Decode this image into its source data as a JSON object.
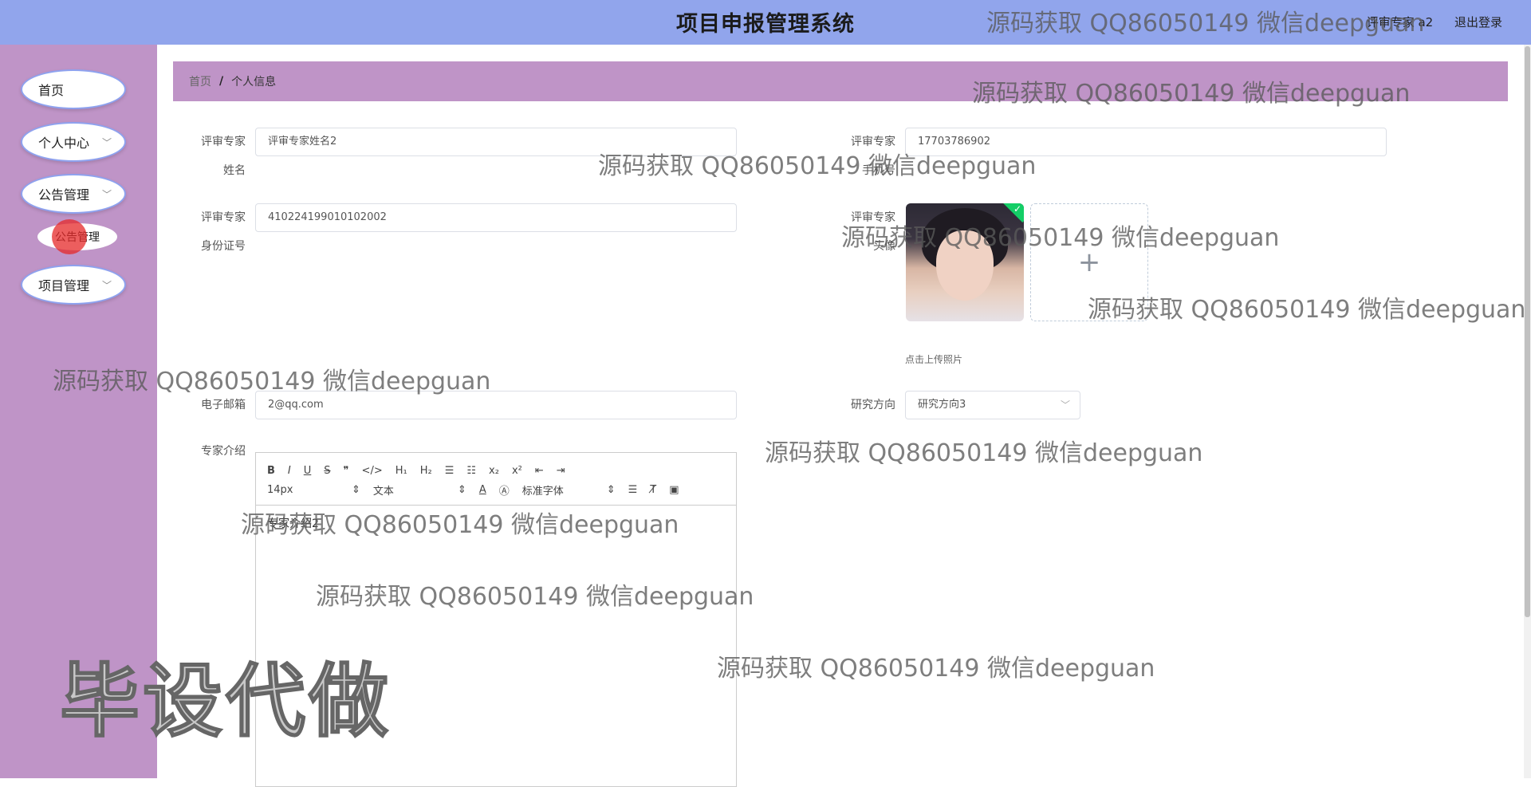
{
  "header": {
    "title": "项目申报管理系统",
    "user": "评审专家 a2",
    "logout": "退出登录"
  },
  "sidebar": {
    "items": [
      {
        "label": "首页"
      },
      {
        "label": "个人中心"
      },
      {
        "label": "公告管理"
      },
      {
        "label": "项目管理"
      }
    ],
    "sub_item": "公告管理"
  },
  "breadcrumb": {
    "home": "首页",
    "separator": "/",
    "current": "个人信息"
  },
  "form": {
    "name_label_1": "评审专家",
    "name_label_2": "姓名",
    "name_value": "评审专家姓名2",
    "phone_label_1": "评审专家",
    "phone_label_2": "手机号",
    "phone_value": "17703786902",
    "id_label_1": "评审专家",
    "id_label_2": "身份证号",
    "id_value": "410224199010102002",
    "avatar_label_1": "评审专家",
    "avatar_label_2": "头像",
    "upload_plus": "+",
    "upload_tip": "点击上传照片",
    "email_label": "电子邮箱",
    "email_value": "2@qq.com",
    "research_label": "研究方向",
    "research_value": "研究方向3",
    "intro_label": "专家介绍",
    "intro_value": "专家介绍2"
  },
  "editor_toolbar": {
    "row1": [
      "B",
      "I",
      "U",
      "S",
      "❞",
      "</>",
      "H₁",
      "H₂",
      "☰",
      "☷",
      "x₂",
      "x²",
      "⇤",
      "⇥"
    ],
    "font_size": "14px",
    "text_type": "文本",
    "font_family": "标准字体"
  },
  "watermarks": {
    "line": "源码获取 QQ86050149 微信deepguan",
    "big": "毕设代做"
  },
  "colors": {
    "topbar": "#91a5ec",
    "sidebar": "#bf94c7",
    "breadcrumb": "#bf94c7"
  }
}
